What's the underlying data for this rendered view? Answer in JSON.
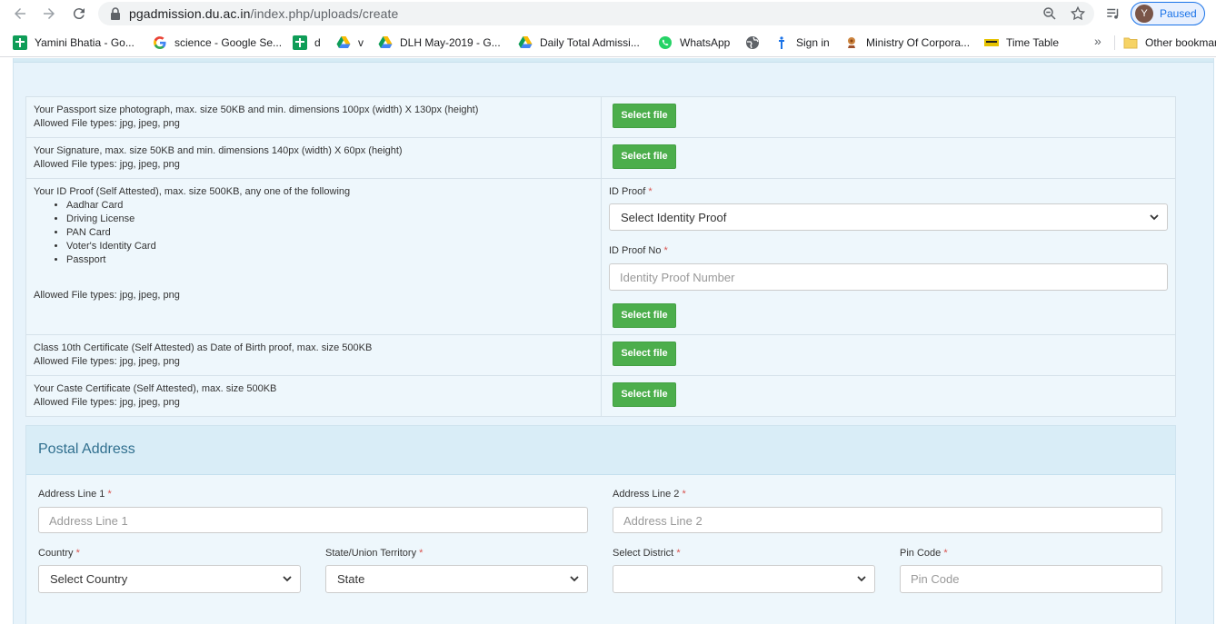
{
  "browser": {
    "url_host": "pgadmission.du.ac.in",
    "url_path": "/index.php/uploads/create",
    "profile_initial": "Y",
    "profile_status": "Paused",
    "bookmarks": [
      {
        "label": "Yamini Bhatia - Go...",
        "icon": "google-sheets-icon"
      },
      {
        "label": "science - Google Se...",
        "icon": "google-g-icon"
      },
      {
        "label": "d",
        "icon": "google-sheets-icon"
      },
      {
        "label": "v",
        "icon": "google-drive-icon"
      },
      {
        "label": "DLH May-2019 - G...",
        "icon": "google-drive-icon"
      },
      {
        "label": "Daily Total Admissi...",
        "icon": "google-drive-icon"
      },
      {
        "label": "WhatsApp",
        "icon": "whatsapp-icon"
      },
      {
        "label": "",
        "icon": "globe-icon"
      },
      {
        "label": "Sign in",
        "icon": "signin-icon"
      },
      {
        "label": "Ministry Of Corpora...",
        "icon": "emblem-icon"
      },
      {
        "label": "Time Table",
        "icon": "timetable-icon"
      }
    ],
    "more_bookmarks": "»",
    "other_bookmarks": "Other bookmarks"
  },
  "uploads": {
    "select_file_label": "Select file",
    "photo": {
      "line1": "Your Passport size photograph, max. size 50KB and min. dimensions 100px (width) X 130px (height)",
      "line2": "Allowed File types: jpg, jpeg, png"
    },
    "signature": {
      "line1": "Your Signature, max. size 50KB and min. dimensions 140px (width) X 60px (height)",
      "line2": "Allowed File types: jpg, jpeg, png"
    },
    "id_proof": {
      "line1": "Your ID Proof (Self Attested), max. size 500KB, any one of the following",
      "options": [
        "Aadhar Card",
        "Driving License",
        "PAN Card",
        "Voter's Identity Card",
        "Passport"
      ],
      "line2": "Allowed File types: jpg, jpeg, png",
      "type_label": "ID Proof",
      "type_value": "Select Identity Proof",
      "number_label": "ID Proof No",
      "number_placeholder": "Identity Proof Number"
    },
    "class10": {
      "line1": "Class 10th Certificate (Self Attested) as Date of Birth proof, max. size 500KB",
      "line2": "Allowed File types: jpg, jpeg, png"
    },
    "caste": {
      "line1": "Your Caste Certificate (Self Attested), max. size 500KB",
      "line2": "Allowed File types: jpg, jpeg, png"
    }
  },
  "postal": {
    "title": "Postal Address",
    "required_mark": "*",
    "address1": {
      "label": "Address Line 1",
      "placeholder": "Address Line 1"
    },
    "address2": {
      "label": "Address Line 2",
      "placeholder": "Address Line 2"
    },
    "country": {
      "label": "Country",
      "value": "Select Country"
    },
    "state": {
      "label": "State/Union Territory",
      "value": "State"
    },
    "district": {
      "label": "Select District",
      "value": ""
    },
    "pincode": {
      "label": "Pin Code",
      "placeholder": "Pin Code"
    }
  },
  "colors": {
    "success_button": "#4cae4c",
    "panel_bg": "#e7f3fb",
    "heading_text": "#31708f",
    "required": "#d9534f"
  }
}
